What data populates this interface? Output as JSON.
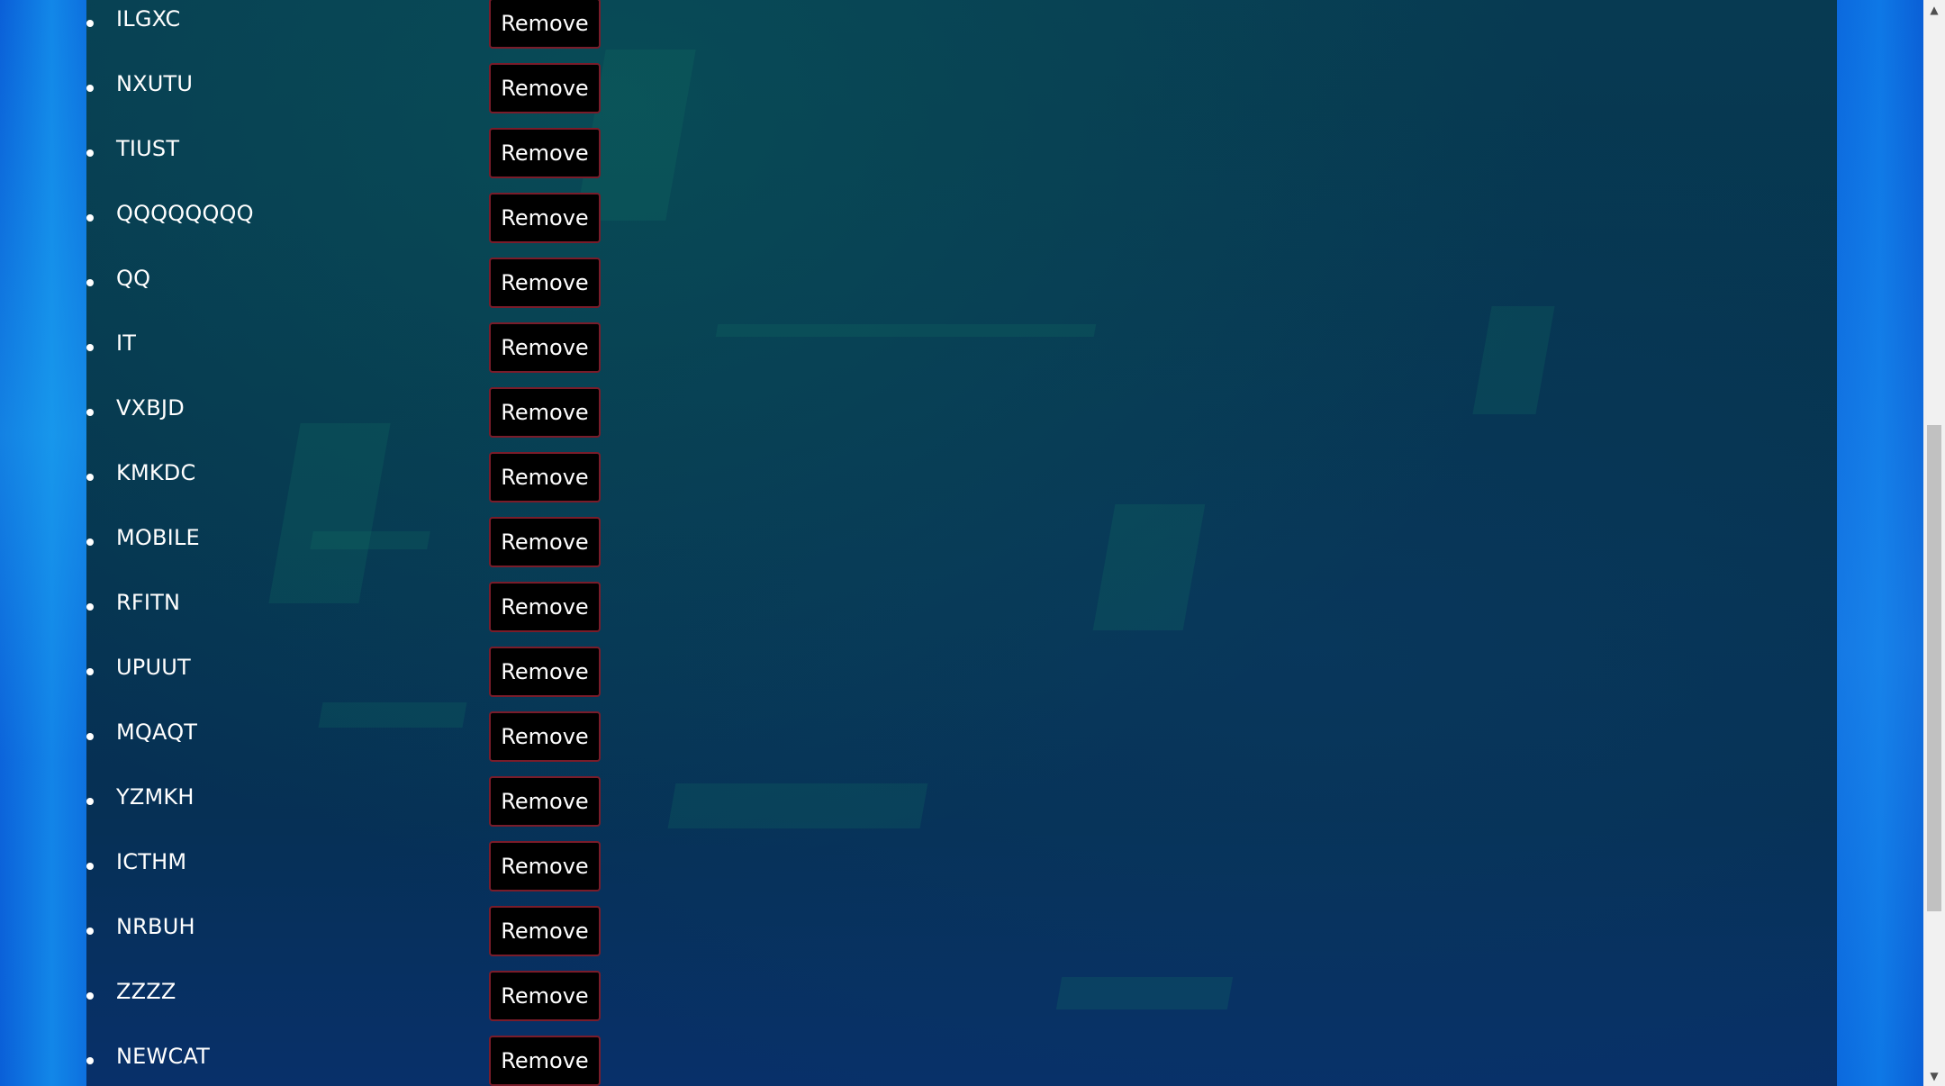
{
  "items": [
    {
      "label": "ILGXC",
      "button": "Remove"
    },
    {
      "label": "NXUTU",
      "button": "Remove"
    },
    {
      "label": "TIUST",
      "button": "Remove"
    },
    {
      "label": "QQQQQQQQ",
      "button": "Remove"
    },
    {
      "label": "QQ",
      "button": "Remove"
    },
    {
      "label": "IT",
      "button": "Remove"
    },
    {
      "label": "VXBJD",
      "button": "Remove"
    },
    {
      "label": "KMKDC",
      "button": "Remove"
    },
    {
      "label": "MOBILE",
      "button": "Remove"
    },
    {
      "label": "RFITN",
      "button": "Remove"
    },
    {
      "label": "UPUUT",
      "button": "Remove"
    },
    {
      "label": "MQAQT",
      "button": "Remove"
    },
    {
      "label": "YZMKH",
      "button": "Remove"
    },
    {
      "label": "ICTHM",
      "button": "Remove"
    },
    {
      "label": "NRBUH",
      "button": "Remove"
    },
    {
      "label": "ZZZZ",
      "button": "Remove"
    },
    {
      "label": "NEWCAT",
      "button": "Remove"
    }
  ],
  "scrollbar": {
    "up_icon": "triangle-up-icon",
    "down_icon": "triangle-down-icon",
    "up_glyph": "▲",
    "down_glyph": "▼"
  },
  "colors": {
    "panel": "#06344f",
    "button_bg": "#000000",
    "button_border": "#7a1c2a",
    "text": "#ffffff"
  }
}
